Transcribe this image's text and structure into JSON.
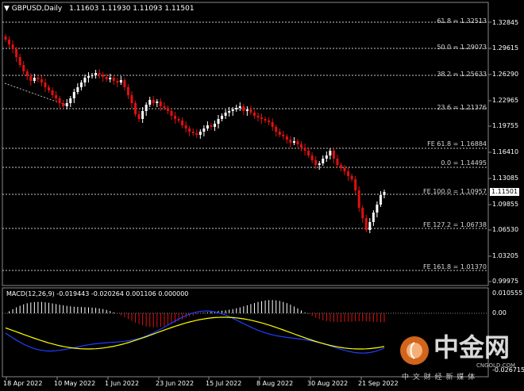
{
  "header": {
    "symbol_label": "GBPUSD,Daily",
    "ohlc": "1.11603 1.11930 1.11093 1.11501"
  },
  "price_axis": {
    "ticks": [
      "1.32845",
      "1.29615",
      "1.26290",
      "1.22965",
      "1.19755",
      "1.16410",
      "1.13085",
      "1.09855",
      "1.06530",
      "1.03205",
      "0.99975"
    ],
    "current_price": "1.11501"
  },
  "levels": [
    {
      "label": "61.8 = 1.32513"
    },
    {
      "label": "50.0 = 1.29073"
    },
    {
      "label": "38.2 = 1.25633"
    },
    {
      "label": "23.6 = 1.21376"
    },
    {
      "label": "FE 61.8 = 1.16884"
    },
    {
      "label": "0.0 = 1.14495"
    },
    {
      "label": "FE 100.0 = 1.10957"
    },
    {
      "label": "FE 127.2 = 1.06738"
    },
    {
      "label": "FE 161.8 = 1.01370"
    }
  ],
  "macd": {
    "label": "MACD(12,26,9) -0.019443 -0.020264 0.001106 0.000000",
    "ticks": [
      "0.010555",
      "0.00",
      "-0.026715"
    ]
  },
  "x_axis": {
    "ticks": [
      "18 Apr 2022",
      "10 May 2022",
      "1 Jun 2022",
      "23 Jun 2022",
      "15 Jul 2022",
      "8 Aug 2022",
      "30 Aug 2022",
      "21 Sep 2022"
    ]
  },
  "logo": {
    "brand": "中金网",
    "domain": "CNGOLD.COM",
    "tagline": "中 文 财 经 新 媒 体"
  },
  "colors": {
    "background": "#000000",
    "bull": "#ffffff",
    "bear": "#e01010",
    "grid": "#c0c0c0",
    "macd_signal": "#ffff00",
    "macd_main": "#1f3fff",
    "logo_orange": "#e8701e"
  }
}
